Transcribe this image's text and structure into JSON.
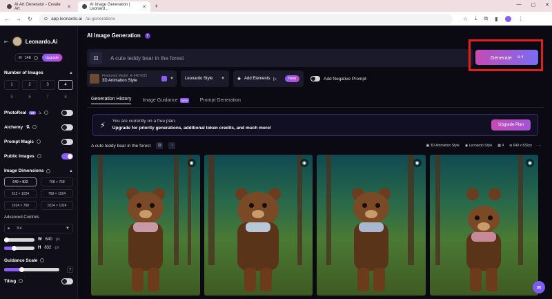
{
  "browser": {
    "tabs": [
      {
        "title": "AI Art Generator - Create Art"
      },
      {
        "title": "AI Image Generation | Leonard..."
      }
    ],
    "url_host": "app.leonardo.ai",
    "url_path": "/ai-generations"
  },
  "sidebar": {
    "brand": "Leonardo.Ai",
    "credits": "146",
    "upgrade_label": "Upgrade",
    "num_images_label": "Number of Images",
    "num_options": [
      "1",
      "2",
      "3",
      "4",
      "5",
      "6",
      "7",
      "8"
    ],
    "selected_num": "4",
    "photoreal_label": "PhotoReal",
    "photoreal_badge": "V2",
    "alchemy_label": "Alchemy",
    "prompt_magic_label": "Prompt Magic",
    "public_images_label": "Public Images",
    "dimensions_label": "Image Dimensions",
    "dimensions": [
      "640 × 832",
      "768 × 768",
      "512 × 1024",
      "768 × 1024",
      "1024 × 768",
      "1024 × 1024"
    ],
    "advanced_label": "Advanced Controls",
    "ratio": "3:4",
    "w_label": "W",
    "w_value": "640",
    "h_label": "H",
    "h_value": "832",
    "px": "px",
    "guidance_label": "Guidance Scale",
    "guidance_value": "7",
    "tiling_label": "Tiling"
  },
  "main": {
    "title": "AI Image Generation",
    "prompt_placeholder": "A cute teddy bear in the forest",
    "generate_label": "Generate",
    "generate_cost": "4",
    "model_sub": "Finetuned Model",
    "model_dims": "640×832",
    "model_name": "3D Animation Style",
    "style_label": "Leonardo Style",
    "add_elements_label": "Add Elements",
    "new_badge": "New",
    "negative_label": "Add Negative Prompt",
    "tabs": [
      "Generation History",
      "Image Guidance",
      "Prompt Generation"
    ],
    "tab_new": "New",
    "banner_line1": "You are currently on a free plan.",
    "banner_line2": "Upgrade for priority generations, additional token credits, and much more!",
    "upgrade_plan_label": "Upgrade Plan",
    "gen_prompt": "A cute teddy bear in the forest",
    "meta_model": "3D Animation Style",
    "meta_style": "Leonardo Style",
    "meta_count": "4",
    "meta_dims": "640 x 832px",
    "meta_more": "···"
  },
  "colors": {
    "accent": "#8b5cf6",
    "highlight_box": "#e81c1c"
  }
}
